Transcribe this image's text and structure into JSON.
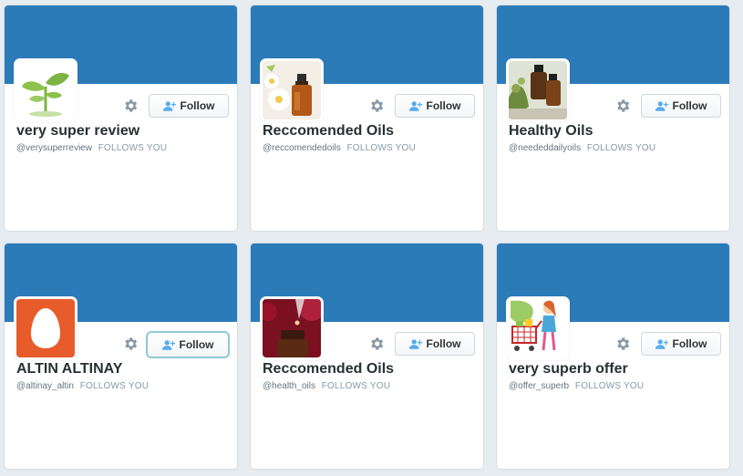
{
  "colors": {
    "banner": "#2b7bb9",
    "background": "#e6ecf0",
    "card": "#ffffff",
    "name_text": "#292f33",
    "meta_text": "#66757f"
  },
  "cards": [
    {
      "name": "very super review",
      "handle": "@verysuperreview",
      "follows_you": "FOLLOWS YOU",
      "follow_label": "Follow",
      "avatar": "sprout-logo",
      "follow_focused": false
    },
    {
      "name": "Reccomended Oils",
      "handle": "@reccomendedoils",
      "follows_you": "FOLLOWS YOU",
      "follow_label": "Follow",
      "avatar": "oil-bottle-daisies",
      "follow_focused": false
    },
    {
      "name": "Healthy Oils",
      "handle": "@neededdailyoils",
      "follows_you": "FOLLOWS YOU",
      "follow_label": "Follow",
      "avatar": "oil-bottles-herbs",
      "follow_focused": false
    },
    {
      "name": "ALTIN ALTINAY",
      "handle": "@altinay_altin",
      "follows_you": "FOLLOWS YOU",
      "follow_label": "Follow",
      "avatar": "default-egg",
      "follow_focused": true
    },
    {
      "name": "Reccomended Oils",
      "handle": "@health_oils",
      "follows_you": "FOLLOWS YOU",
      "follow_label": "Follow",
      "avatar": "dropper-bottle",
      "follow_focused": false
    },
    {
      "name": "very superb offer",
      "handle": "@offer_superb",
      "follows_you": "FOLLOWS YOU",
      "follow_label": "Follow",
      "avatar": "shopping-girl-cart",
      "follow_focused": false
    }
  ]
}
